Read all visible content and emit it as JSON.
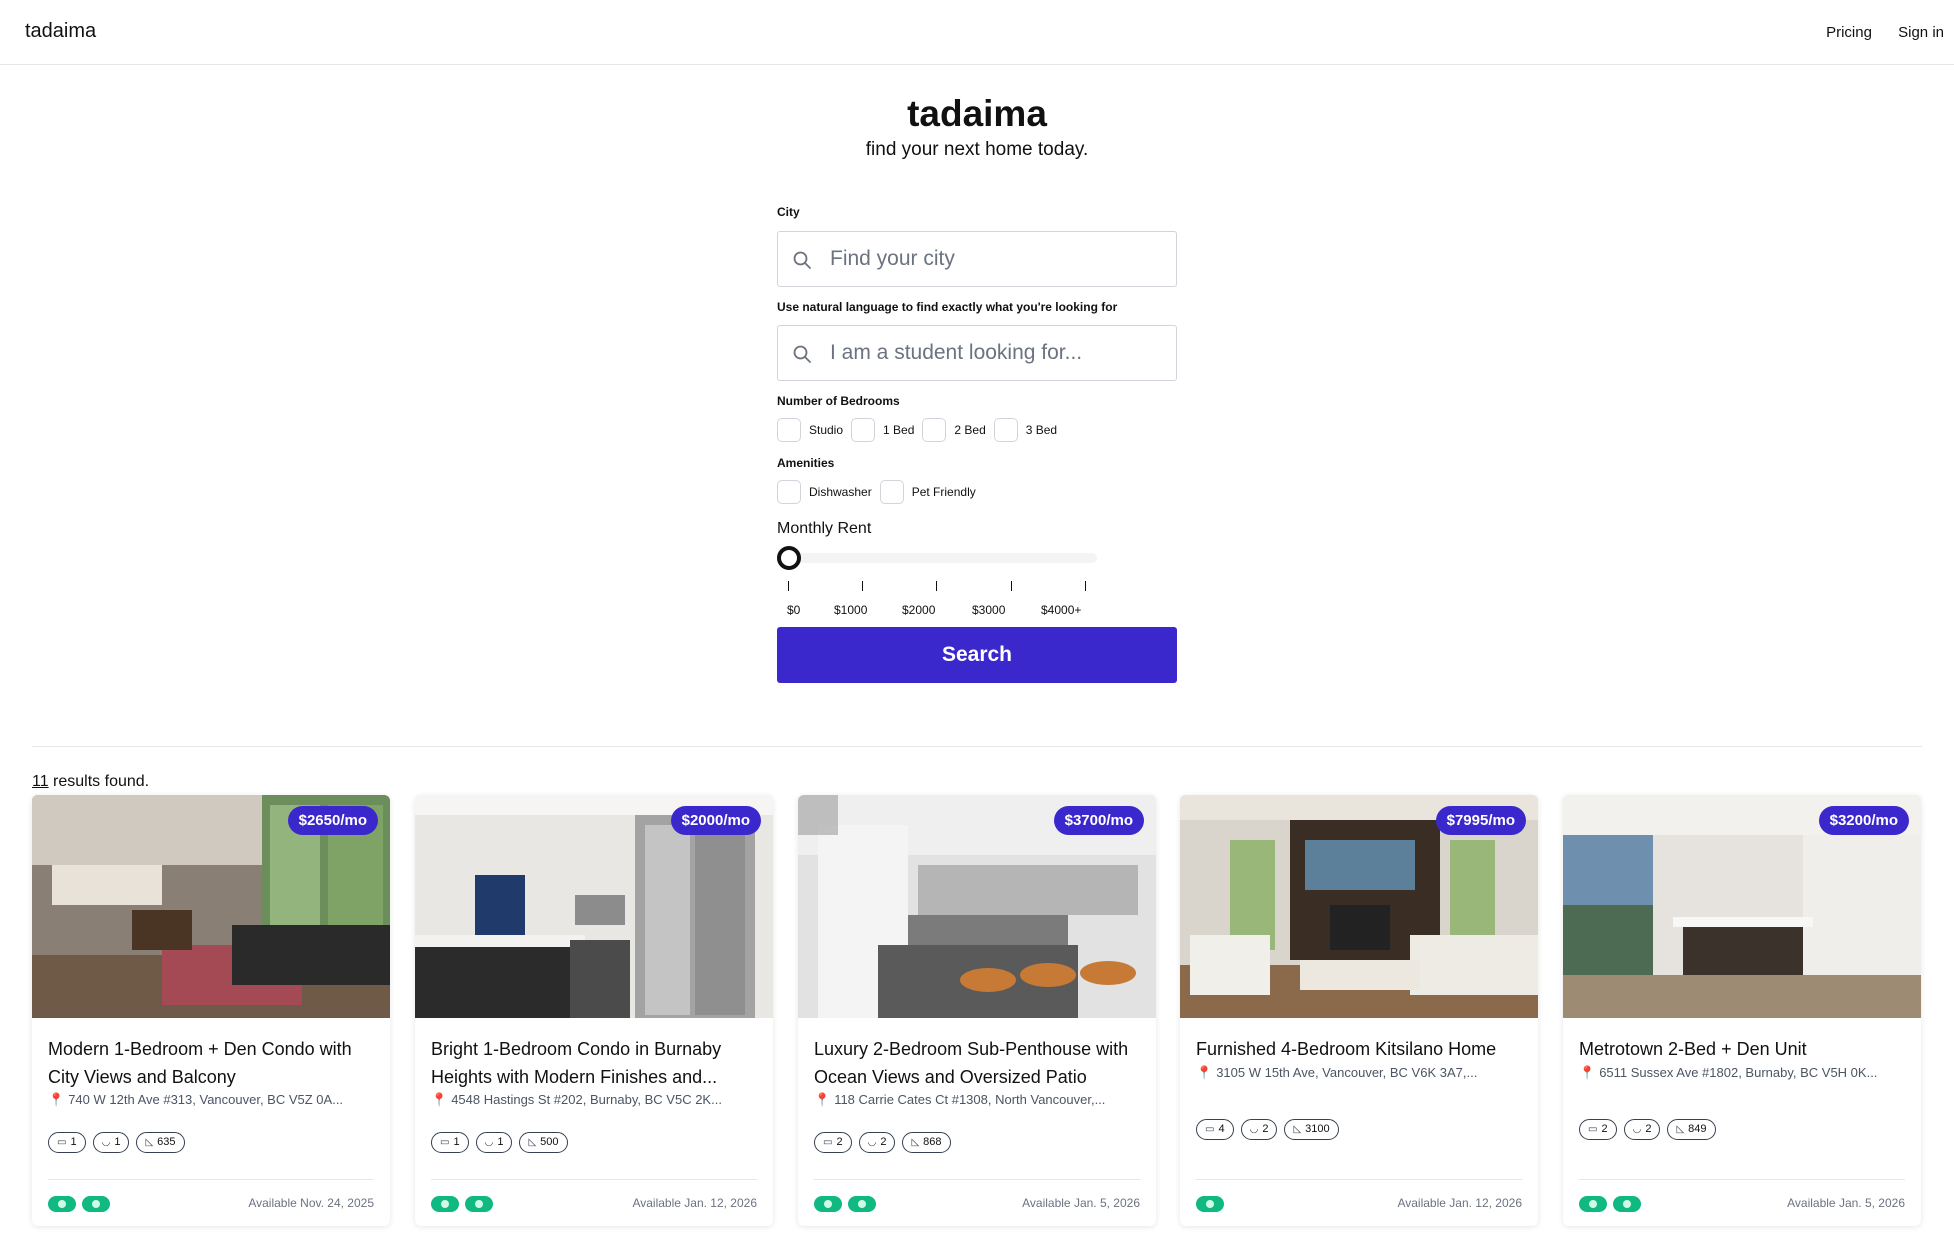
{
  "app": {
    "brand": "tadaima"
  },
  "nav": {
    "pricing": "Pricing",
    "signin": "Sign in"
  },
  "hero": {
    "title": "tadaima",
    "subtitle": "find your next home today."
  },
  "form": {
    "city_label": "City",
    "city_placeholder": "Find your city",
    "nl_label": "Use natural language to find exactly what you're looking for",
    "nl_placeholder": "I am a student looking for...",
    "bedrooms_label": "Number of Bedrooms",
    "bedrooms": [
      "Studio",
      "1 Bed",
      "2 Bed",
      "3 Bed"
    ],
    "amenities_label": "Amenities",
    "amenities": [
      "Dishwasher",
      "Pet Friendly"
    ],
    "rent_label": "Monthly Rent",
    "rent_ticks": [
      "$0",
      "$1000",
      "$2000",
      "$3000",
      "$4000+"
    ],
    "rent_value": 0,
    "search_button": "Search"
  },
  "results": {
    "count": "11",
    "suffix": " results found."
  },
  "listings": [
    {
      "price": "$2650/mo",
      "title": "Modern 1-Bedroom + Den Condo with City Views and Balcony",
      "address": "740 W 12th Ave #313, Vancouver, BC V5Z 0A...",
      "beds": "1",
      "baths": "1",
      "sqft": "635",
      "available": "Available Nov. 24, 2025",
      "features": 2
    },
    {
      "price": "$2000/mo",
      "title": "Bright 1-Bedroom Condo in Burnaby Heights with Modern Finishes and...",
      "address": "4548 Hastings St #202, Burnaby, BC V5C 2K...",
      "beds": "1",
      "baths": "1",
      "sqft": "500",
      "available": "Available Jan. 12, 2026",
      "features": 2
    },
    {
      "price": "$3700/mo",
      "title": "Luxury 2-Bedroom Sub-Penthouse with Ocean Views and Oversized Patio",
      "address": "118 Carrie Cates Ct #1308, North Vancouver,...",
      "beds": "2",
      "baths": "2",
      "sqft": "868",
      "available": "Available Jan. 5, 2026",
      "features": 2
    },
    {
      "price": "$7995/mo",
      "title": "Furnished 4-Bedroom Kitsilano Home",
      "address": "3105 W 15th Ave, Vancouver, BC V6K 3A7,...",
      "beds": "4",
      "baths": "2",
      "sqft": "3100",
      "available": "Available Jan. 12, 2026",
      "features": 1
    },
    {
      "price": "$3200/mo",
      "title": "Metrotown 2-Bed + Den Unit",
      "address": "6511 Sussex Ave #1802, Burnaby, BC V5H 0K...",
      "beds": "2",
      "baths": "2",
      "sqft": "849",
      "available": "Available Jan. 5, 2026",
      "features": 2
    }
  ],
  "icons": {
    "search": "search-icon",
    "pin": "map-pin-icon",
    "bed": "bed-icon",
    "bath": "bath-icon",
    "area": "area-icon"
  },
  "colors": {
    "accent": "#3b28cc",
    "feature": "#10b981"
  }
}
